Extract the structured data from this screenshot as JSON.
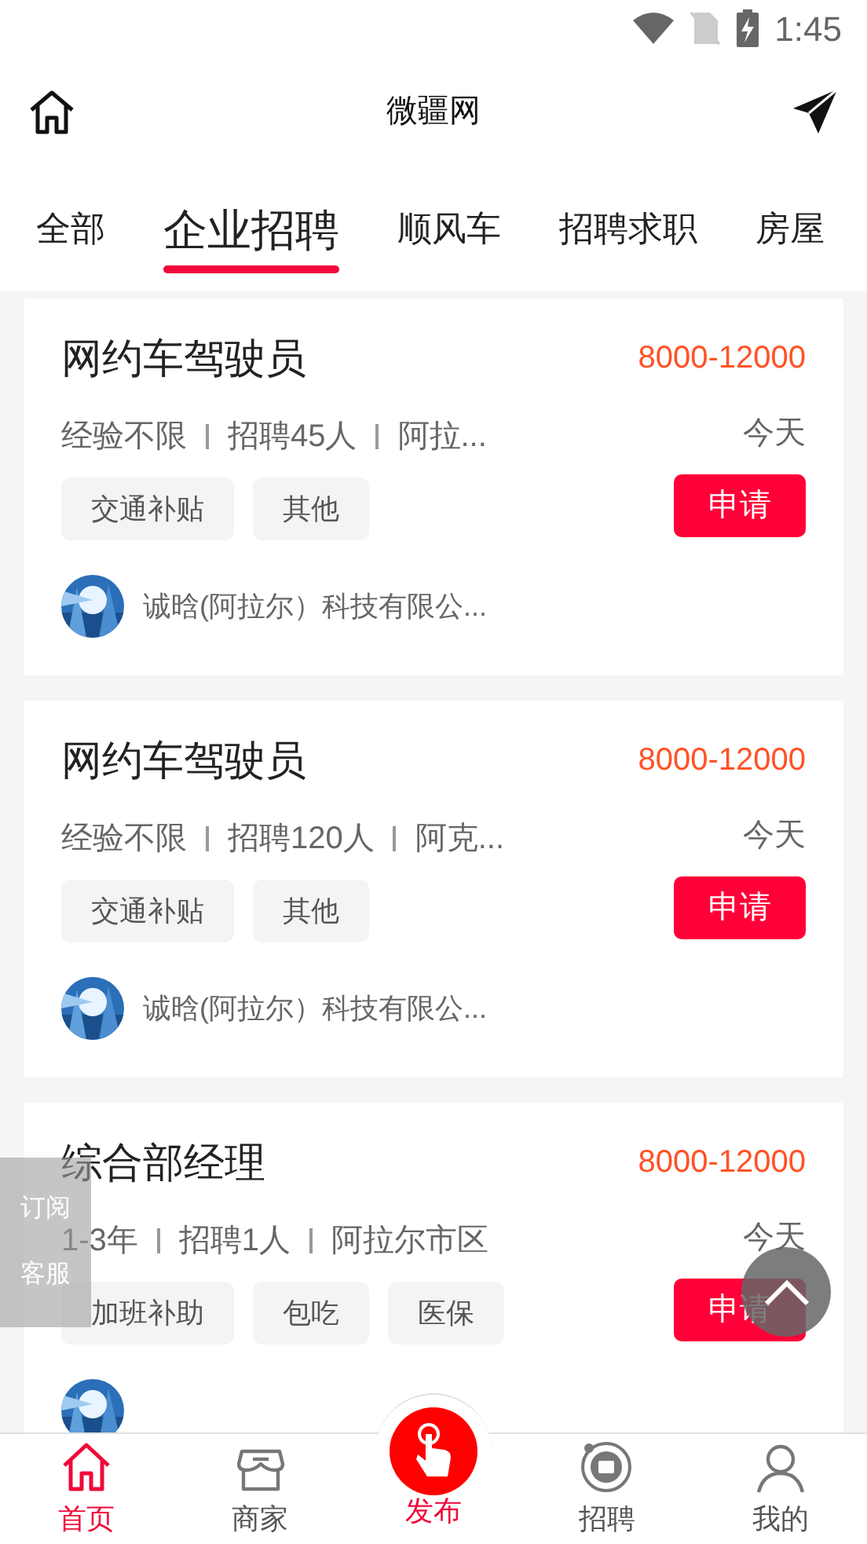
{
  "status_bar": {
    "time": "1:45"
  },
  "header": {
    "title": "微疆网"
  },
  "tabs": [
    {
      "label": "全部",
      "selected": false
    },
    {
      "label": "企业招聘",
      "selected": true
    },
    {
      "label": "顺风车",
      "selected": false
    },
    {
      "label": "招聘求职",
      "selected": false
    },
    {
      "label": "房屋",
      "selected": false
    }
  ],
  "jobs": [
    {
      "title": "网约车驾驶员",
      "salary": "8000-12000",
      "meta": [
        "经验不限",
        "招聘45人",
        "阿拉..."
      ],
      "date": "今天",
      "tags": [
        "交通补贴",
        "其他"
      ],
      "apply": "申请",
      "company": "诚晗(阿拉尔）科技有限公..."
    },
    {
      "title": "网约车驾驶员",
      "salary": "8000-12000",
      "meta": [
        "经验不限",
        "招聘120人",
        "阿克..."
      ],
      "date": "今天",
      "tags": [
        "交通补贴",
        "其他"
      ],
      "apply": "申请",
      "company": "诚晗(阿拉尔）科技有限公..."
    },
    {
      "title": "综合部经理",
      "salary": "8000-12000",
      "meta": [
        "1-3年",
        "招聘1人",
        "阿拉尔市区"
      ],
      "date": "今天",
      "tags": [
        "加班补助",
        "包吃",
        "医保"
      ],
      "apply": "申请"
    }
  ],
  "float_panel": [
    "订阅",
    "客服"
  ],
  "bottom_nav": [
    {
      "label": "首页",
      "kind": "home",
      "selected": true
    },
    {
      "label": "商家",
      "kind": "shop",
      "selected": false
    },
    {
      "label": "发布",
      "kind": "publish",
      "selected": false
    },
    {
      "label": "招聘",
      "kind": "hire",
      "selected": false
    },
    {
      "label": "我的",
      "kind": "me",
      "selected": false
    }
  ]
}
